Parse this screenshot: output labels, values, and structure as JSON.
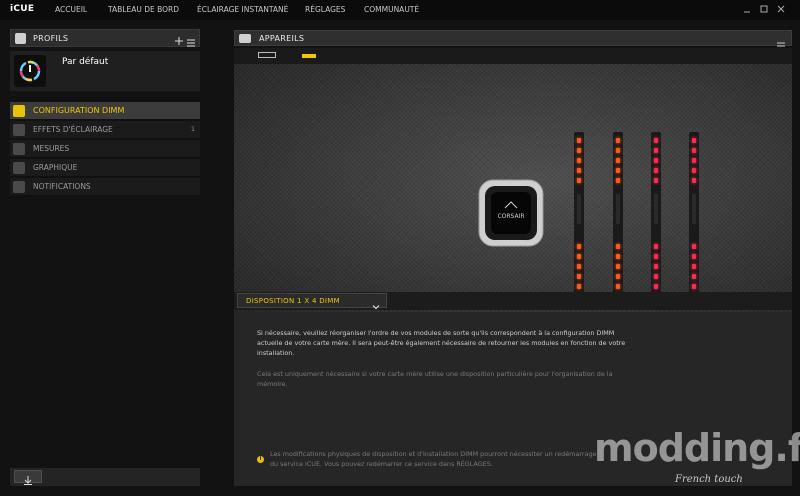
{
  "app": {
    "brand": "iCUE"
  },
  "nav": {
    "items": [
      "ACCUEIL",
      "TABLEAU DE BORD",
      "ÉCLAIRAGE INSTANTANÉ",
      "RÉGLAGES",
      "COMMUNAUTÉ"
    ]
  },
  "window": {
    "controls": [
      "minimize-icon",
      "maximize-icon",
      "close-icon"
    ]
  },
  "profiles": {
    "header": "PROFILS",
    "active_profile": "Par défaut"
  },
  "sidebar": {
    "items": [
      {
        "label": "CONFIGURATION DIMM",
        "active": true
      },
      {
        "label": "EFFETS D'ÉCLAIRAGE",
        "badge": "1"
      },
      {
        "label": "MESURES"
      },
      {
        "label": "GRAPHIQUE"
      },
      {
        "label": "NOTIFICATIONS"
      }
    ]
  },
  "devices": {
    "header": "APPAREILS"
  },
  "dimm": {
    "layout_select": "DISPOSITION 1 X 4 DIMM",
    "pump_brand": "CORSAIR",
    "info_primary": "Si nécessaire, veuillez réorganiser l'ordre de vos modules de sorte qu'ils correspondent à la configuration DIMM actuelle de votre carte mère. Il sera peut-être également nécessaire de retourner les modules en fonction de votre installation.",
    "info_secondary": "Cela est uniquement nécessaire si votre carte mère utilise une disposition particulière pour l'organisation de la mémoire.",
    "info_warning": "Les modifications physiques de disposition et d'installation DIMM pourront nécessiter un redémarrage du service iCUE. Vous pouvez redémarrer ce service dans RÉGLAGES."
  },
  "watermark": {
    "text": "modding.fr",
    "sub": "French touch"
  },
  "colors": {
    "accent": "#f0c800",
    "led_orange": "#ff5a1e",
    "led_red": "#ff2a4a"
  }
}
